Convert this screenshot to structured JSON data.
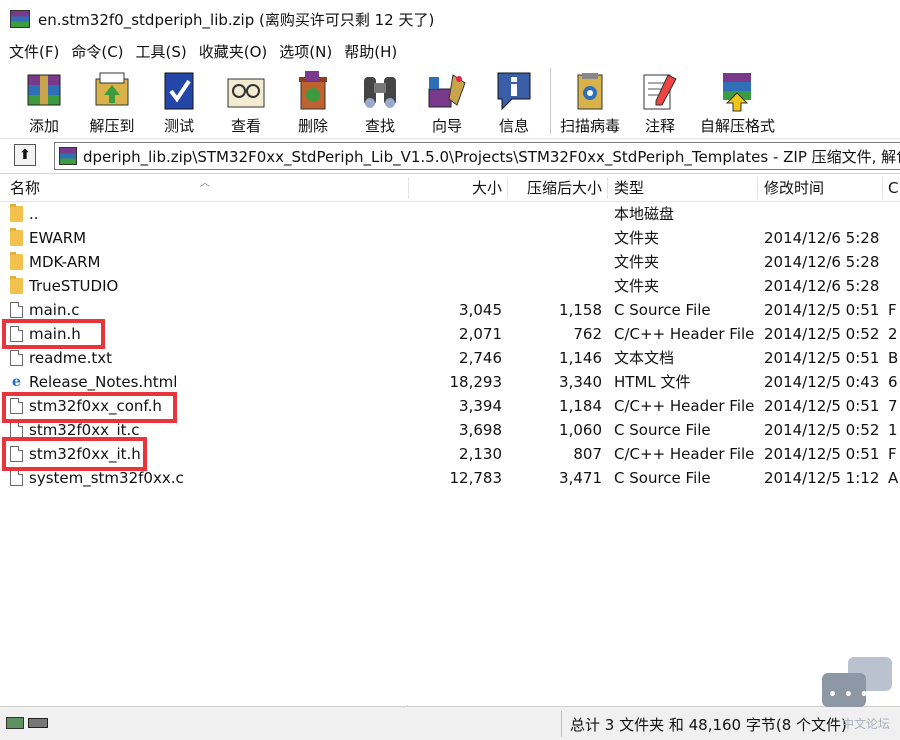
{
  "window": {
    "title": "en.stm32f0_stdperiph_lib.zip (离购买许可只剩 12 天了)"
  },
  "menu": [
    "文件(F)",
    "命令(C)",
    "工具(S)",
    "收藏夹(O)",
    "选项(N)",
    "帮助(H)"
  ],
  "toolbar": [
    {
      "label": "添加",
      "icon": "add-archive-icon"
    },
    {
      "label": "解压到",
      "icon": "extract-to-icon"
    },
    {
      "label": "测试",
      "icon": "test-icon"
    },
    {
      "label": "查看",
      "icon": "view-icon"
    },
    {
      "label": "删除",
      "icon": "delete-icon"
    },
    {
      "label": "查找",
      "icon": "find-icon"
    },
    {
      "label": "向导",
      "icon": "wizard-icon"
    },
    {
      "label": "信息",
      "icon": "info-icon"
    },
    {
      "label": "扫描病毒",
      "icon": "virus-scan-icon"
    },
    {
      "label": "注释",
      "icon": "comment-icon"
    },
    {
      "label": "自解压格式",
      "icon": "sfx-icon"
    }
  ],
  "address": {
    "path": "dperiph_lib.zip\\STM32F0xx_StdPeriph_Lib_V1.5.0\\Projects\\STM32F0xx_StdPeriph_Templates - ZIP 压缩文件, 解包大小为"
  },
  "columns": {
    "name": "名称",
    "size": "大小",
    "packed": "压缩后大小",
    "type": "类型",
    "modified": "修改时间",
    "crc": "C"
  },
  "files": [
    {
      "name": "..",
      "size": "",
      "packed": "",
      "type": "本地磁盘",
      "modified": "",
      "crc": "",
      "icon": "folder-icon"
    },
    {
      "name": "EWARM",
      "size": "",
      "packed": "",
      "type": "文件夹",
      "modified": "2014/12/6 5:28",
      "crc": "",
      "icon": "folder-icon"
    },
    {
      "name": "MDK-ARM",
      "size": "",
      "packed": "",
      "type": "文件夹",
      "modified": "2014/12/6 5:28",
      "crc": "",
      "icon": "folder-icon"
    },
    {
      "name": "TrueSTUDIO",
      "size": "",
      "packed": "",
      "type": "文件夹",
      "modified": "2014/12/6 5:28",
      "crc": "",
      "icon": "folder-icon"
    },
    {
      "name": "main.c",
      "size": "3,045",
      "packed": "1,158",
      "type": "C Source File",
      "modified": "2014/12/5 0:51",
      "crc": "F",
      "icon": "file-icon"
    },
    {
      "name": "main.h",
      "size": "2,071",
      "packed": "762",
      "type": "C/C++ Header File",
      "modified": "2014/12/5 0:52",
      "crc": "2",
      "icon": "file-icon"
    },
    {
      "name": "readme.txt",
      "size": "2,746",
      "packed": "1,146",
      "type": "文本文档",
      "modified": "2014/12/5 0:51",
      "crc": "B",
      "icon": "text-file-icon"
    },
    {
      "name": "Release_Notes.html",
      "size": "18,293",
      "packed": "3,340",
      "type": "HTML 文件",
      "modified": "2014/12/5 0:43",
      "crc": "6",
      "icon": "ie-html-icon"
    },
    {
      "name": "stm32f0xx_conf.h",
      "size": "3,394",
      "packed": "1,184",
      "type": "C/C++ Header File",
      "modified": "2014/12/5 0:51",
      "crc": "7",
      "icon": "file-icon"
    },
    {
      "name": "stm32f0xx_it.c",
      "size": "3,698",
      "packed": "1,060",
      "type": "C Source File",
      "modified": "2014/12/5 0:52",
      "crc": "1",
      "icon": "file-icon"
    },
    {
      "name": "stm32f0xx_it.h",
      "size": "2,130",
      "packed": "807",
      "type": "C/C++ Header File",
      "modified": "2014/12/5 0:51",
      "crc": "F",
      "icon": "file-icon"
    },
    {
      "name": "system_stm32f0xx.c",
      "size": "12,783",
      "packed": "3,471",
      "type": "C Source File",
      "modified": "2014/12/5 1:12",
      "crc": "A",
      "icon": "file-icon"
    }
  ],
  "status": {
    "summary": "总计 3 文件夹 和 48,160 字节(8 个文件)"
  },
  "watermark": {
    "text": "中文论坛"
  },
  "colors": {
    "highlight": "#e8343b",
    "folder": "#f2c14e"
  }
}
